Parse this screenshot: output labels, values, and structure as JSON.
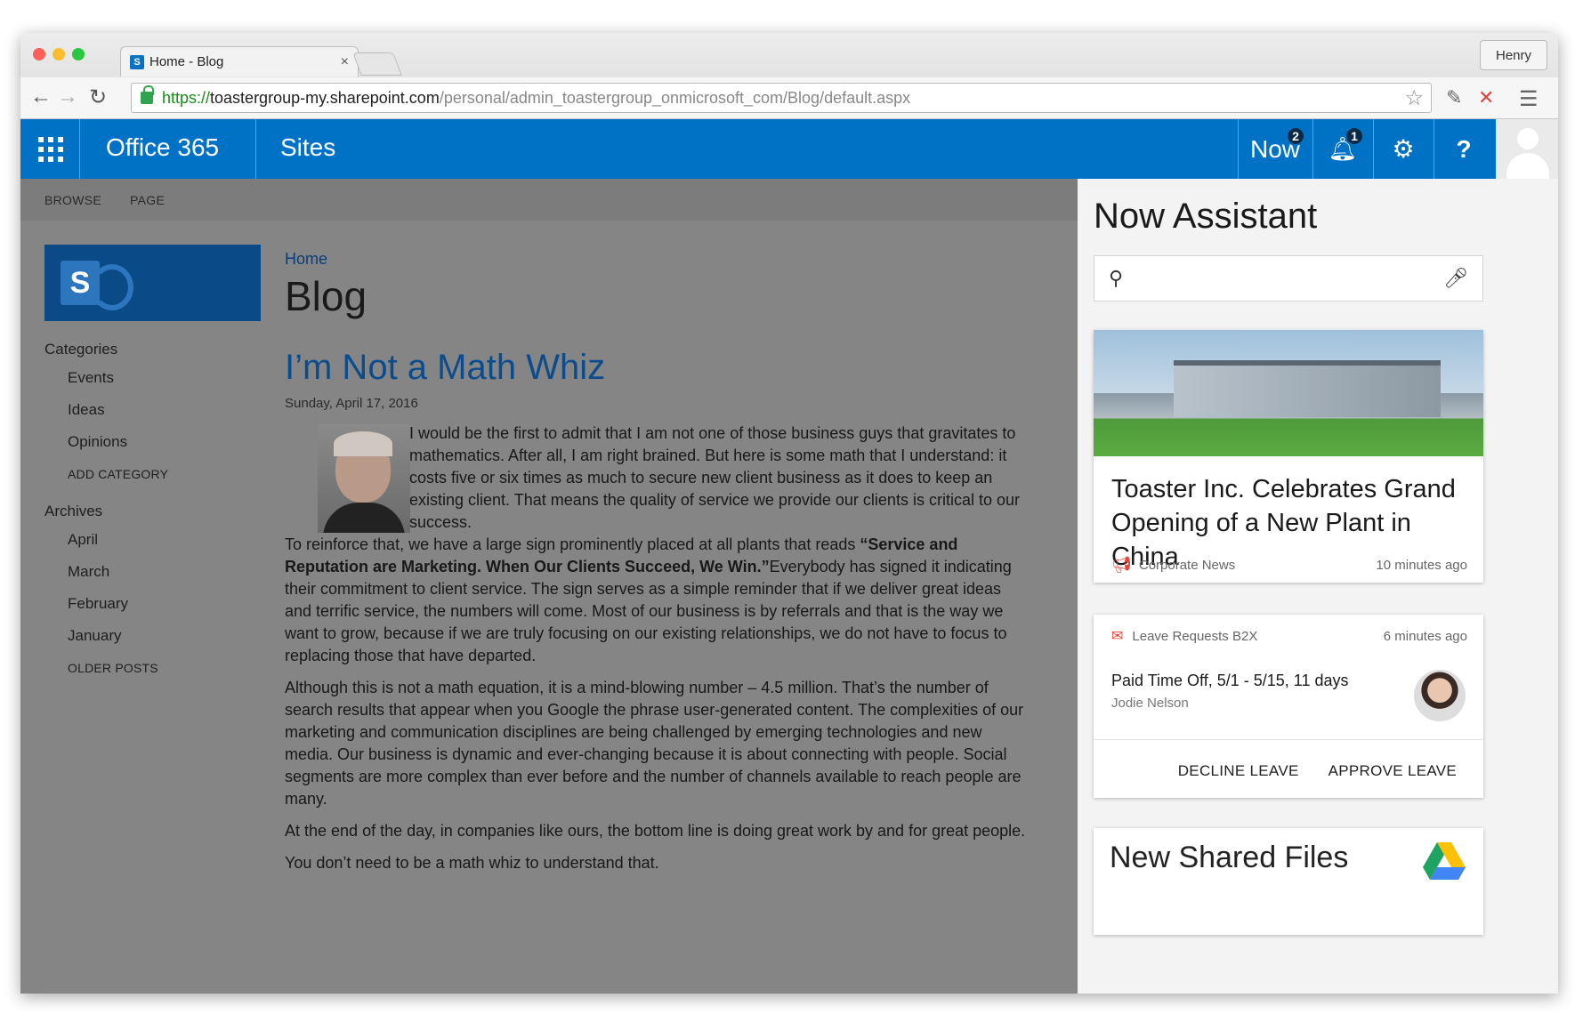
{
  "browser": {
    "tab_title": "Home - Blog",
    "tab_close": "×",
    "user": "Henry",
    "url_scheme": "https://",
    "url_host": "toastergroup-my.sharepoint.com",
    "url_path": "/personal/admin_toastergroup_onmicrosoft_com/Blog/default.aspx"
  },
  "suite": {
    "brand": "Office 365",
    "section": "Sites",
    "now_label": "Now",
    "now_badge": "2",
    "bell_badge": "1",
    "help": "?"
  },
  "ribbon": {
    "browse": "BROWSE",
    "page": "PAGE"
  },
  "leftnav": {
    "categories_heading": "Categories",
    "categories": [
      "Events",
      "Ideas",
      "Opinions"
    ],
    "add_category": "ADD CATEGORY",
    "archives_heading": "Archives",
    "archives": [
      "April",
      "March",
      "February",
      "January"
    ],
    "older_posts": "OLDER POSTS"
  },
  "page": {
    "breadcrumb": "Home",
    "title": "Blog",
    "post_title": "I’m Not a Math Whiz",
    "post_date": "Sunday, April 17, 2016",
    "p1_a": "I would be the first to admit that I am not one of those business guys that gravitates to mathematics. After all, I am right brained. But here is some math that I understand: it costs five or six times as much to secure new client business as it does to keep an existing client. That means the quality of service we provide our clients is critical to our success.",
    "p1_b": "To reinforce that, we have a large sign prominently placed at all plants that reads ",
    "p1_bold": "“Service and Reputation are Marketing. When Our Clients Succeed, We Win.”",
    "p1_c": "Everybody has signed it indicating their commitment to client service. The sign serves as a simple reminder that if we deliver great ideas and terrific service, the numbers will come. Most of our business is by referrals and that is the way we want to grow, because if we are truly focusing on our existing relationships, we do not have to focus to replacing those that have departed.",
    "p2": "Although this is not a math equation, it is a mind-blowing number – 4.5 million. That’s the number of search results that appear when you Google the phrase user-generated content. The complexities of our marketing and communication disciplines are being challenged by emerging technologies and new media. Our business is dynamic and ever-changing because it is about connecting with people. Social segments are more complex than ever before and the number of channels available to reach people are many.",
    "p3": "At the end of the day, in companies like ours, the bottom line is doing great work by and for great people.",
    "p4": "You don’t need to be a math whiz to understand that."
  },
  "assistant": {
    "title": "Now Assistant",
    "news": {
      "headline": "Toaster Inc. Celebrates Grand Opening of a New Plant in China",
      "source": "Corporate News",
      "time": "10 minutes ago"
    },
    "leave": {
      "source": "Leave Requests B2X",
      "time": "6 minutes ago",
      "title": "Paid Time Off, 5/1 - 5/15, 11 days",
      "person": "Jodie Nelson",
      "decline": "DECLINE LEAVE",
      "approve": "APPROVE LEAVE"
    },
    "files_title": "New Shared Files"
  },
  "colors": {
    "suite_blue": "#0072c6",
    "link_blue": "#0b4c8e",
    "alert_red": "#e2463b"
  }
}
